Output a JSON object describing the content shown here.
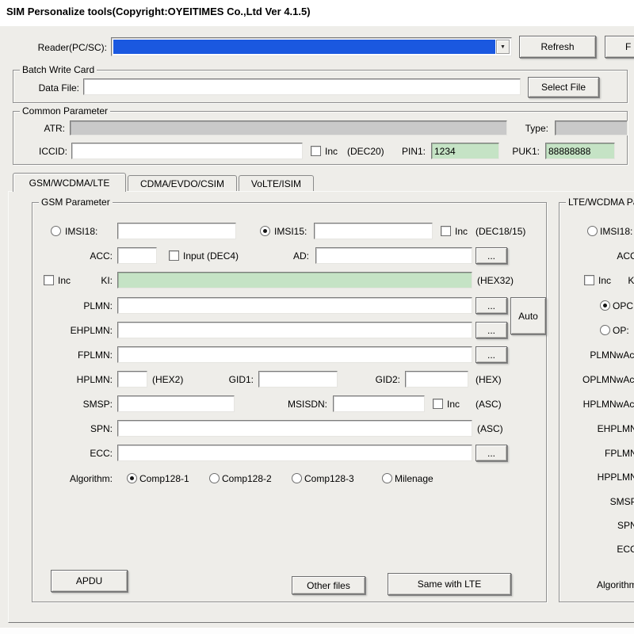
{
  "window": {
    "title": "SIM Personalize tools(Copyright:OYEITIMES Co.,Ltd Ver 4.1.5)"
  },
  "colors": {
    "selection_blue": "#1a58e0",
    "value_green": "#c5e3c5",
    "readonly_gray": "#c9c9c9",
    "dialog_background": "#eeede9"
  },
  "icons": {
    "dropdown_arrow": "▼"
  },
  "reader": {
    "label": "Reader(PC/SC):",
    "value": "",
    "refresh_button": "Refresh",
    "partial_button": "F"
  },
  "batch": {
    "title": "Batch Write Card",
    "data_file_label": "Data File:",
    "data_file_value": "",
    "select_file_button": "Select File"
  },
  "common": {
    "title": "Common Parameter",
    "atr_label": "ATR:",
    "atr_value": "",
    "type_label": "Type:",
    "type_value": "",
    "iccid_label": "ICCID:",
    "iccid_value": "",
    "inc_label": "Inc",
    "dec20_label": "(DEC20)",
    "pin1_label": "PIN1:",
    "pin1_value": "1234",
    "puk1_label": "PUK1:",
    "puk1_value": "88888888"
  },
  "tabs": [
    {
      "label": "GSM/WCDMA/LTE",
      "active": true
    },
    {
      "label": "CDMA/EVDO/CSIM",
      "active": false
    },
    {
      "label": "VoLTE/ISIM",
      "active": false
    }
  ],
  "gsm": {
    "title": "GSM Parameter",
    "imsi18_label": "IMSI18:",
    "imsi18_value": "",
    "imsi18_selected": false,
    "imsi15_label": "IMSI15:",
    "imsi15_value": "",
    "imsi15_selected": true,
    "inc1_label": "Inc",
    "dec1815_label": "(DEC18/15)",
    "acc_label": "ACC:",
    "acc_value": "",
    "input_dec4_label": "Input (DEC4)",
    "ad_label": "AD:",
    "ad_value": "",
    "ad_browse": "...",
    "inc_ki_label": "Inc",
    "ki_label": "KI:",
    "ki_value": "",
    "hex32_label": "(HEX32)",
    "plmn_label": "PLMN:",
    "plmn_value": "",
    "plmn_browse": "...",
    "auto_button": "Auto",
    "ehplmn_label": "EHPLMN:",
    "ehplmn_value": "",
    "ehplmn_browse": "...",
    "fplmn_label": "FPLMN:",
    "fplmn_value": "",
    "fplmn_browse": "...",
    "hplmn_label": "HPLMN:",
    "hplmn_value": "",
    "hex2_label": "(HEX2)",
    "gid1_label": "GID1:",
    "gid1_value": "",
    "gid2_label": "GID2:",
    "gid2_value": "",
    "hex_label": "(HEX)",
    "smsp_label": "SMSP:",
    "smsp_value": "",
    "msisdn_label": "MSISDN:",
    "msisdn_value": "",
    "inc_msisdn_label": "Inc",
    "asc1_label": "(ASC)",
    "spn_label": "SPN:",
    "spn_value": "",
    "asc2_label": "(ASC)",
    "ecc_label": "ECC:",
    "ecc_value": "",
    "ecc_browse": "...",
    "algorithm_label": "Algorithm:",
    "alg_options": [
      {
        "label": "Comp128-1",
        "selected": true
      },
      {
        "label": "Comp128-2",
        "selected": false
      },
      {
        "label": "Comp128-3",
        "selected": false
      },
      {
        "label": "Milenage",
        "selected": false
      }
    ],
    "apdu_button": "APDU",
    "other_files_button": "Other files",
    "same_with_lte_button": "Same with LTE"
  },
  "lte": {
    "title": "LTE/WCDMA Parameter",
    "imsi18_label": "IMSI18:",
    "imsi18_selected": false,
    "acc_label": "ACC:",
    "inc_ki_label": "Inc",
    "ki_label": "KI:",
    "opc_label": "OPC:",
    "opc_selected": true,
    "op_label": "OP:",
    "op_selected": false,
    "plmnwact_label": "PLMNwAct:",
    "oplmnwact_label": "OPLMNwAct:",
    "hplmnwact_label": "HPLMNwAct:",
    "ehplmn_label": "EHPLMN:",
    "fplmn_label": "FPLMN:",
    "hpplmn_label": "HPPLMN:",
    "smsp_label": "SMSP:",
    "spn_label": "SPN:",
    "ecc_label": "ECC:",
    "algorithm_label": "Algorithm:"
  }
}
